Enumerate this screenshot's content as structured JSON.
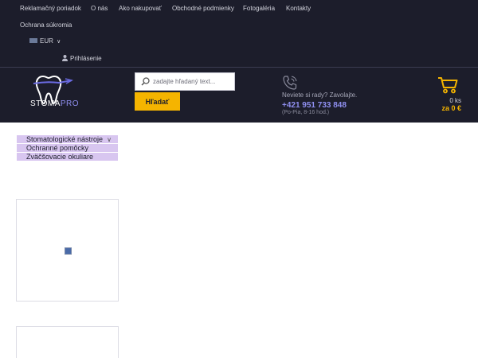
{
  "top_nav": {
    "links": [
      "Reklamačný poriadok",
      "O nás",
      "Ako nakupovať",
      "Obchodné podmienky",
      "Fotogaléria",
      "Kontakty",
      "Ochrana súkromia"
    ]
  },
  "currency": {
    "label": "EUR"
  },
  "account": {
    "login_label": "Prihlásenie"
  },
  "logo": {
    "part1": "STOMA",
    "part2": "PRO"
  },
  "search": {
    "placeholder": "zadajte hľadaný text...",
    "button_label": "Hľadať"
  },
  "contact": {
    "question": "Neviete si rady? Zavolajte.",
    "phone": "+421 951 733 848",
    "hours": "(Po-Pia, 8-16 hod.)"
  },
  "cart": {
    "count": "0 ks",
    "total": "za 0 €"
  },
  "categories": [
    {
      "label": "Stomatologické nástroje"
    },
    {
      "label": "Ochranné pomôcky"
    },
    {
      "label": "Zväčšovacie okuliare"
    }
  ],
  "colors": {
    "header_bg": "#1c1d2b",
    "accent": "#f5b400",
    "brand": "#8f8ff0",
    "category_bg": "#d8c6f0"
  }
}
